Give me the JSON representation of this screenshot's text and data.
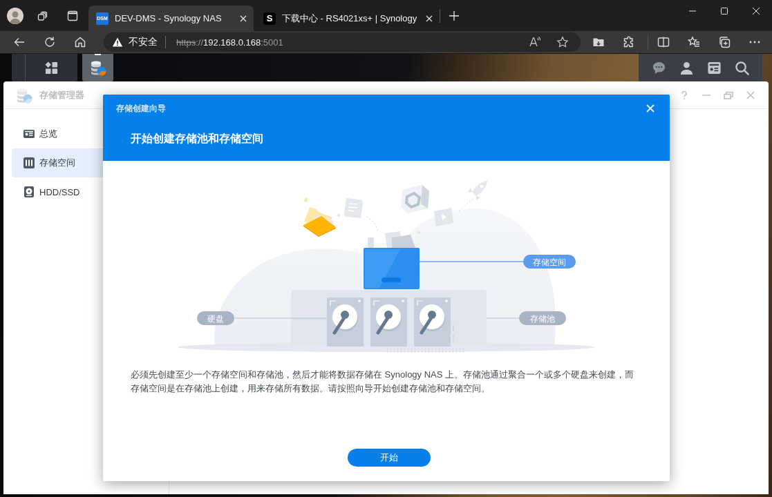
{
  "browser": {
    "tabs": [
      {
        "favicon_text": "DSM",
        "title": "DEV-DMS - Synology NAS",
        "selected": true
      },
      {
        "favicon_text": "S",
        "title": "下载中心 - RS4021xs+ | Synology",
        "selected": false
      }
    ],
    "address_bar": {
      "security_label": "不安全",
      "url_parts": [
        {
          "kind": "struck",
          "text": "https"
        },
        {
          "kind": "dim",
          "text": "://"
        },
        {
          "kind": "host",
          "text": "192.168.0.168"
        },
        {
          "kind": "dim",
          "text": ":5001"
        }
      ]
    }
  },
  "taskbar": {
    "apps": [
      {
        "selected": true
      }
    ]
  },
  "storage_manager": {
    "title": "存储管理器",
    "sidebar": [
      {
        "label": "总览",
        "selected": false
      },
      {
        "label": "存储空间",
        "selected": true
      },
      {
        "label": "HDD/SSD",
        "selected": false
      }
    ]
  },
  "wizard": {
    "title": "存储创建向导",
    "heading": "开始创建存储池和存储空间",
    "illustration": {
      "volume_label": "存储空间",
      "disk_label": "硬盘",
      "pool_label": "存储池"
    },
    "description": "必须先创建至少一个存储空间和存储池，然后才能将数据存储在 Synology NAS 上。存储池通过聚合一个或多个硬盘来创建，而存储空间是在存储池上创建，用来存储所有数据。请按照向导开始创建存储池和存储空间。",
    "button": "开始"
  }
}
